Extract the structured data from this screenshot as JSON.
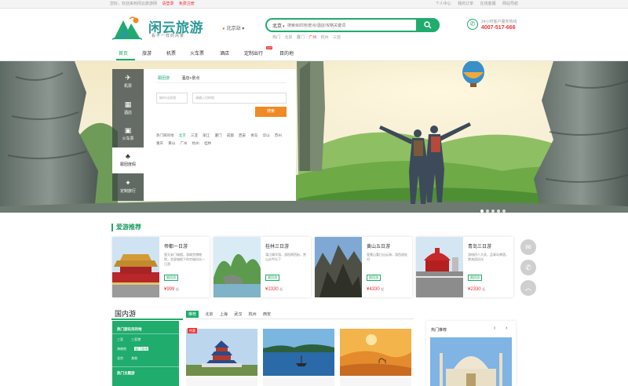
{
  "topbar": {
    "left": [
      "您好，欢迎来到闲云旅游网",
      "请登录",
      "免费注册"
    ],
    "right": [
      "个人中心",
      "我的订单",
      "在线客服",
      "网站导航"
    ]
  },
  "brand": {
    "name": "闲云旅游",
    "slogan": "看不一样的风景"
  },
  "location": {
    "city": "北京站"
  },
  "search": {
    "dest_label": "北京",
    "placeholder": "搜索目的地/景点/酒店/攻略关键词",
    "button_icon": "search-icon",
    "hot": [
      "热门",
      "北京",
      "厦门",
      "广州",
      "杭州",
      "三亚"
    ]
  },
  "hotline": {
    "label": "24小时客户服务热线",
    "number": "4007-517-666"
  },
  "nav": {
    "items": [
      "首页",
      "旅游",
      "机票",
      "火车票",
      "酒店",
      "定制出行",
      "目的地"
    ],
    "active_index": 0,
    "badge": "HOT"
  },
  "side_menu": {
    "items": [
      {
        "label": "机票",
        "icon": "plane-icon"
      },
      {
        "label": "酒店",
        "icon": "hotel-icon"
      },
      {
        "label": "火车票",
        "icon": "train-icon"
      },
      {
        "label": "跟团度假",
        "icon": "palm-icon"
      },
      {
        "label": "定制旅行",
        "icon": "compass-icon"
      }
    ],
    "active_index": 3
  },
  "booking": {
    "tabs": [
      "跟团游",
      "酒店+景点"
    ],
    "origin_placeholder": "城市/出发地",
    "dest_placeholder": "请输入目的地",
    "submit": "搜索",
    "links": [
      "热门目的地",
      "北京",
      "三亚",
      "丽江",
      "厦门",
      "成都",
      "西安",
      "青岛",
      "华山",
      "苏州",
      "重庆",
      "黄山",
      "广州",
      "杭州",
      "桂林"
    ]
  },
  "banner": {
    "slide_count": 5,
    "active_slide": 0
  },
  "recommend": {
    "title": "爱游推荐",
    "cards": [
      {
        "title": "帝都一日游",
        "desc": "登天安门城楼，游故宫博物院，览皇城根下的京城风光一日游",
        "tag": "跟团游",
        "price": "¥999",
        "unit": "起"
      },
      {
        "title": "桂林三日游",
        "desc": "漓江精华游，游阳朔西街，赏山水甲天下",
        "tag": "跟团游",
        "price": "¥2330",
        "unit": "起"
      },
      {
        "title": "黄山五日游",
        "desc": "登黄山看日出云海，游西递宏村",
        "tag": "跟团游",
        "price": "¥4330",
        "unit": "起"
      },
      {
        "title": "青岛三日游",
        "desc": "游栈桥八大关，品青岛啤酒，赏海滨风光",
        "tag": "跟团游",
        "price": "¥2330",
        "unit": "起"
      }
    ]
  },
  "float_tools": [
    "chat-icon",
    "phone-icon",
    "top-icon"
  ],
  "domestic": {
    "title": "国内游",
    "tabs": [
      "推荐",
      "北京",
      "上海",
      "武汉",
      "杭州",
      "西安"
    ],
    "active_tab": 0,
    "guide": {
      "h1": "热门游玩目的地",
      "row1": [
        "三亚",
        "三亚港"
      ],
      "row2": [
        "海南热",
        "厦门游览"
      ],
      "row3": [
        "北京",
        "其他"
      ],
      "h2": "热门主题游"
    },
    "badge": "特惠",
    "related": "热门推荐"
  }
}
